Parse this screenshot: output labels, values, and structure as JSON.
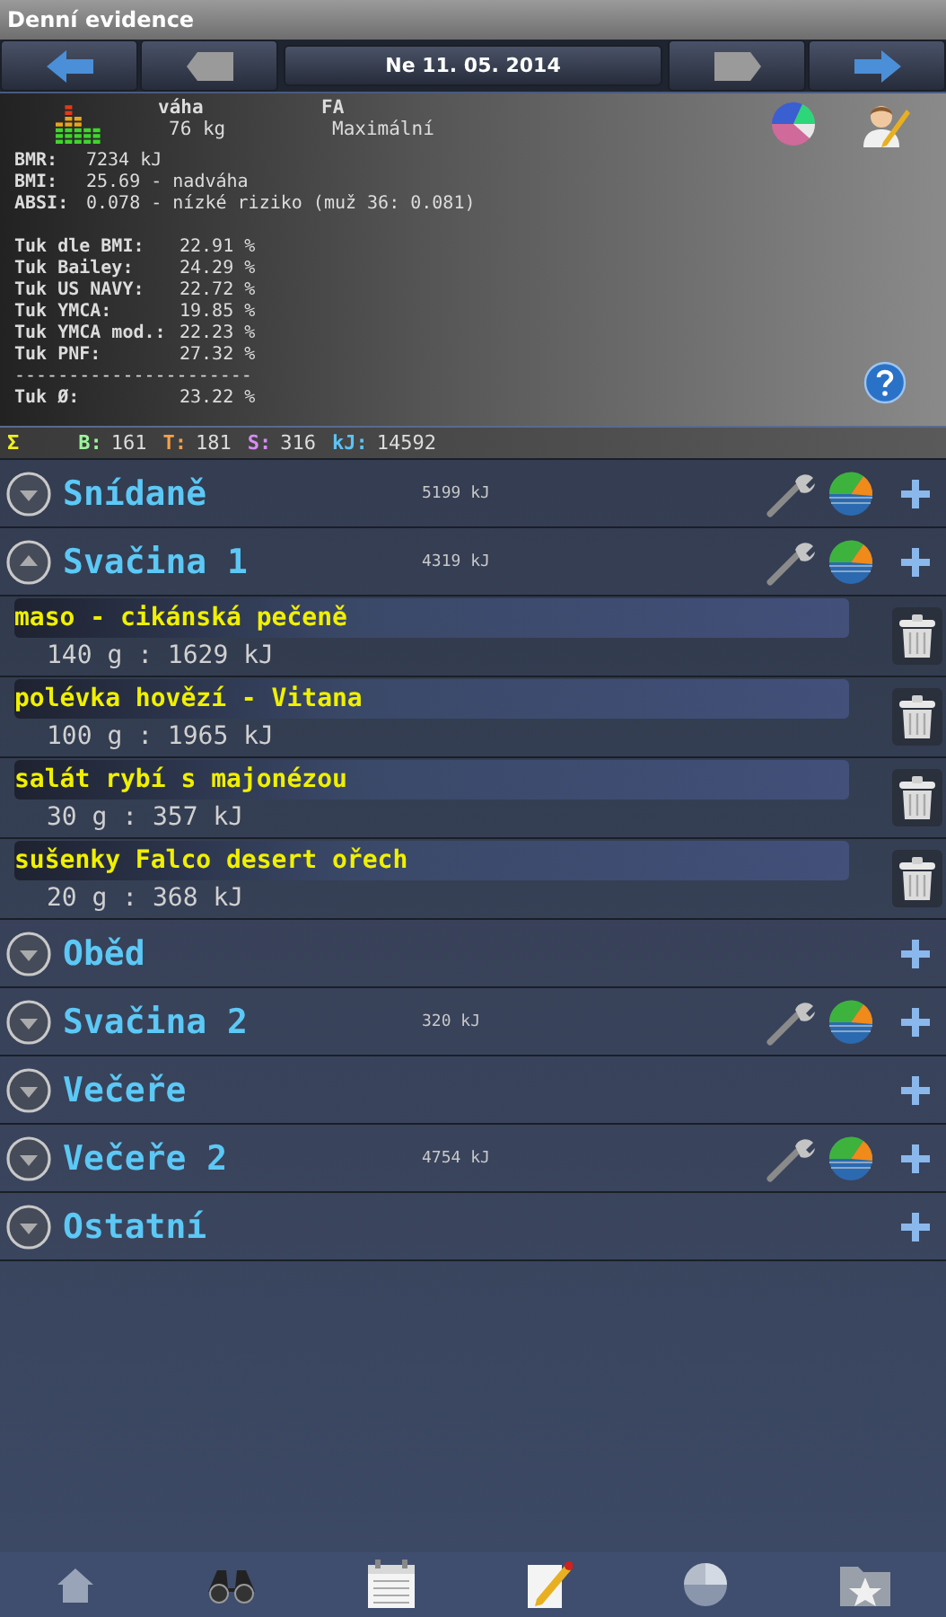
{
  "window": {
    "title": "Denní evidence"
  },
  "nav": {
    "date": "Ne 11. 05. 2014"
  },
  "profile": {
    "weight_label": "váha",
    "weight": "76 kg",
    "fa_label": "FA",
    "fa": "Maximální"
  },
  "stats": [
    {
      "label": "BMR:",
      "value": "7234 kJ"
    },
    {
      "label": "BMI:",
      "value": "25.69 - nadváha"
    },
    {
      "label": "ABSI:",
      "value": "0.078 - nízké riziko (muž 36: 0.081)"
    }
  ],
  "fat": [
    {
      "label": "Tuk dle BMI:",
      "value": "22.91 %"
    },
    {
      "label": "Tuk Bailey:",
      "value": "24.29 %"
    },
    {
      "label": "Tuk US NAVY:",
      "value": "22.72 %"
    },
    {
      "label": "Tuk YMCA:",
      "value": "19.85 %"
    },
    {
      "label": "Tuk YMCA mod.:",
      "value": "22.23 %"
    },
    {
      "label": "Tuk PNF:",
      "value": "27.32 %"
    }
  ],
  "separator": "----------------------",
  "fat_average": {
    "label": "Tuk Ø:",
    "value": "23.22 %"
  },
  "totals": {
    "symbol": "Σ",
    "items": [
      {
        "label": "B:",
        "value": "161",
        "color": "#9cf59c"
      },
      {
        "label": "T:",
        "value": "181",
        "color": "#f5a04a"
      },
      {
        "label": "S:",
        "value": "316",
        "color": "#d68ef5"
      },
      {
        "label": "kJ:",
        "value": "14592",
        "color": "#5cc3f5"
      }
    ]
  },
  "meals": [
    {
      "name": "Snídaně",
      "energy": "5199 kJ",
      "expanded": false,
      "tools": true
    },
    {
      "name": "Svačina 1",
      "energy": "4319 kJ",
      "expanded": true,
      "tools": true,
      "items": [
        {
          "name": "maso - cikánská pečeně",
          "amount": "140 g : 1629 kJ"
        },
        {
          "name": "polévka hovězí - Vitana",
          "amount": "100 g : 1965 kJ"
        },
        {
          "name": "salát rybí s majonézou",
          "amount": "30 g : 357 kJ"
        },
        {
          "name": "sušenky Falco desert ořech",
          "amount": "20 g : 368 kJ"
        }
      ]
    },
    {
      "name": "Oběd",
      "expanded": false,
      "tools": false
    },
    {
      "name": "Svačina 2",
      "energy": "320 kJ",
      "expanded": false,
      "tools": true
    },
    {
      "name": "Večeře",
      "expanded": false,
      "tools": false
    },
    {
      "name": "Večeře 2",
      "energy": "4754 kJ",
      "expanded": false,
      "tools": true
    },
    {
      "name": "Ostatní",
      "expanded": false,
      "tools": false
    }
  ],
  "toolbar": [
    {
      "kind": "home"
    },
    {
      "kind": "binoculars"
    },
    {
      "kind": "notepad"
    },
    {
      "kind": "pencil"
    },
    {
      "kind": "chart"
    },
    {
      "kind": "folder"
    }
  ]
}
